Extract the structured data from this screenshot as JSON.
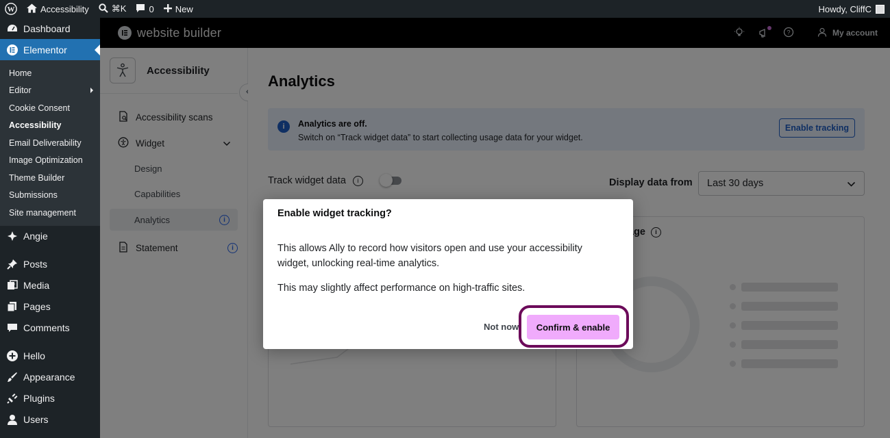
{
  "adminbar": {
    "site_name": "Accessibility",
    "search_shortcut": "⌘K",
    "comments_count": "0",
    "new_label": "New",
    "howdy": "Howdy, CliffC"
  },
  "wp_menu": {
    "dashboard": "Dashboard",
    "elementor": "Elementor",
    "submenu": [
      "Home",
      "Editor",
      "Cookie Consent",
      "Accessibility",
      "Email Deliverability",
      "Image Optimization",
      "Theme Builder",
      "Submissions",
      "Site management"
    ],
    "angie": "Angie",
    "posts": "Posts",
    "media": "Media",
    "pages": "Pages",
    "comments": "Comments",
    "hello": "Hello",
    "appearance": "Appearance",
    "plugins": "Plugins",
    "users": "Users"
  },
  "elementor_header": {
    "brand": "website builder",
    "my_account": "My account"
  },
  "plugin_sidebar": {
    "title": "Accessibility",
    "scans": "Accessibility scans",
    "widget": "Widget",
    "design": "Design",
    "capabilities": "Capabilities",
    "analytics": "Analytics",
    "statement": "Statement"
  },
  "main": {
    "title": "Analytics",
    "alert_title": "Analytics are off.",
    "alert_text": "Switch on “Track widget data” to start collecting usage data for your widget.",
    "enable_tracking": "Enable tracking",
    "track_widget_data": "Track widget data",
    "display_data_from": "Display data from",
    "date_range": "Last 30 days",
    "usage_title_partial": "age"
  },
  "modal": {
    "title": "Enable widget tracking?",
    "body_1": "This allows Ally to record how visitors open and use your accessibility widget, unlocking real-time analytics.",
    "body_2": "This may slightly affect performance on high-traffic sites.",
    "not_now": "Not now",
    "confirm": "Confirm & enable"
  },
  "colors": {
    "wp_dark": "#1d2327",
    "wp_active": "#2271b1",
    "alert_bg": "#e8f0fc",
    "confirm_bg": "#f0abfc",
    "highlight_ring": "#6c0b5a"
  }
}
